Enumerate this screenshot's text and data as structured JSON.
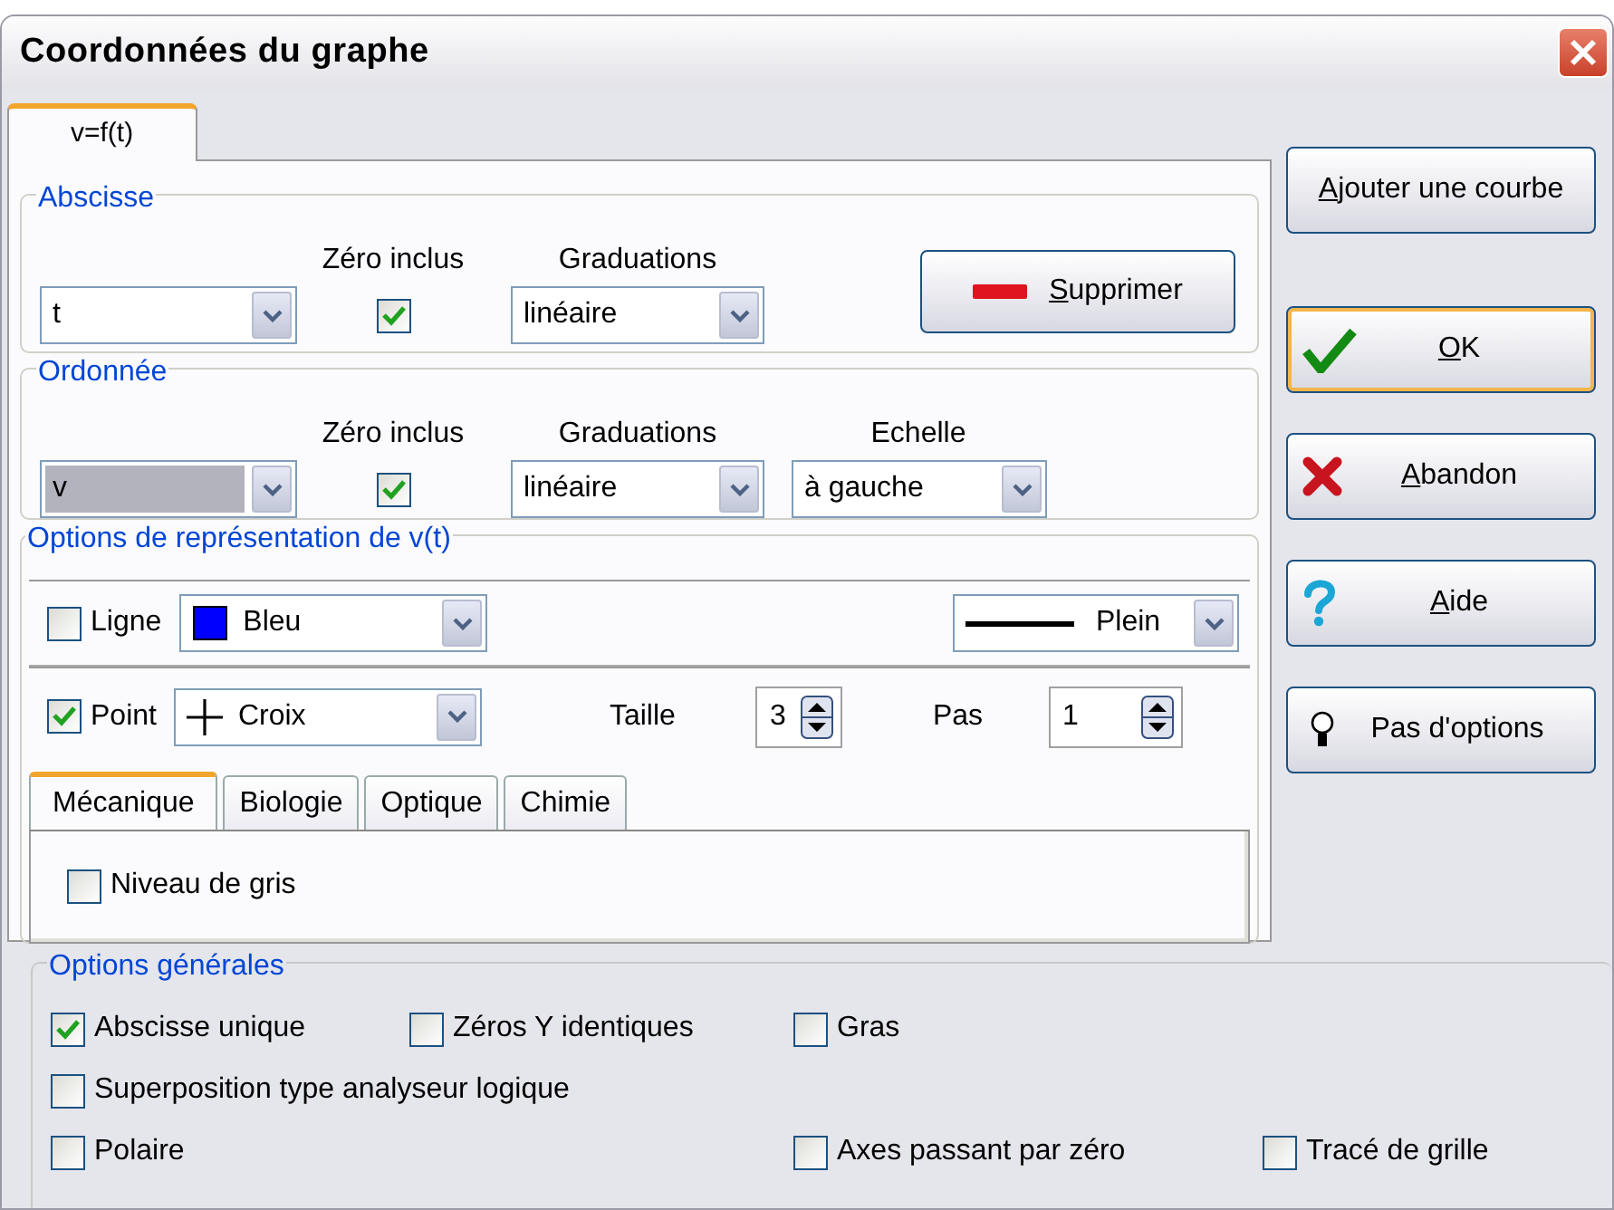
{
  "window": {
    "title": "Coordonnées du graphe"
  },
  "tabs": [
    {
      "label": "v=f(t)",
      "selected": true
    }
  ],
  "abscisse": {
    "legend": "Abscisse",
    "variable": {
      "value": "t",
      "selected": false
    },
    "zero": {
      "label": "Zéro inclus",
      "checked": true
    },
    "graduations": {
      "label": "Graduations",
      "value": "linéaire"
    },
    "delete_button": {
      "label": "Supprimer",
      "first_letter_underlined": true
    }
  },
  "ordonnee": {
    "legend": "Ordonnée",
    "variable": {
      "value": "v",
      "selected": true
    },
    "zero": {
      "label": "Zéro inclus",
      "checked": true
    },
    "graduations": {
      "label": "Graduations",
      "value": "linéaire"
    },
    "scale": {
      "label": "Echelle",
      "value": "à gauche"
    }
  },
  "representation": {
    "legend": "Options de représentation de v(t)",
    "line": {
      "label": "Ligne",
      "checked": false,
      "color_name": "Bleu",
      "color": "#0000ff",
      "style": "Plein"
    },
    "point": {
      "label": "Point",
      "checked": true,
      "shape": "Croix",
      "size_label": "Taille",
      "size": "3",
      "step_label": "Pas",
      "step": "1"
    },
    "subtabs": [
      {
        "label": "Mécanique",
        "selected": true
      },
      {
        "label": "Biologie",
        "selected": false
      },
      {
        "label": "Optique",
        "selected": false
      },
      {
        "label": "Chimie",
        "selected": false
      }
    ],
    "grayscale": {
      "label": "Niveau de gris",
      "checked": false
    }
  },
  "side_buttons": [
    {
      "kind": "plain",
      "label": "Ajouter une courbe",
      "first_letter_underlined": true,
      "default": false
    },
    {
      "kind": "ok",
      "label": "OK",
      "first_letter_underlined": true,
      "default": true
    },
    {
      "kind": "cancel",
      "label": "Abandon",
      "first_letter_underlined": true,
      "default": false
    },
    {
      "kind": "help",
      "label": "Aide",
      "first_letter_underlined": true,
      "default": false
    },
    {
      "kind": "options",
      "label": "Pas d'options",
      "first_letter_underlined": false,
      "default": false
    }
  ],
  "general": {
    "legend": "Options générales",
    "options": [
      {
        "label": "Abscisse unique",
        "checked": true
      },
      {
        "label": "Zéros Y identiques",
        "checked": false
      },
      {
        "label": "Gras",
        "checked": false
      },
      {
        "label": "Superposition type analyseur logique",
        "checked": false
      },
      {
        "label": "Polaire",
        "checked": false
      },
      {
        "label": "Axes passant par zéro",
        "checked": false
      },
      {
        "label": "Tracé de grille",
        "checked": false
      }
    ]
  }
}
